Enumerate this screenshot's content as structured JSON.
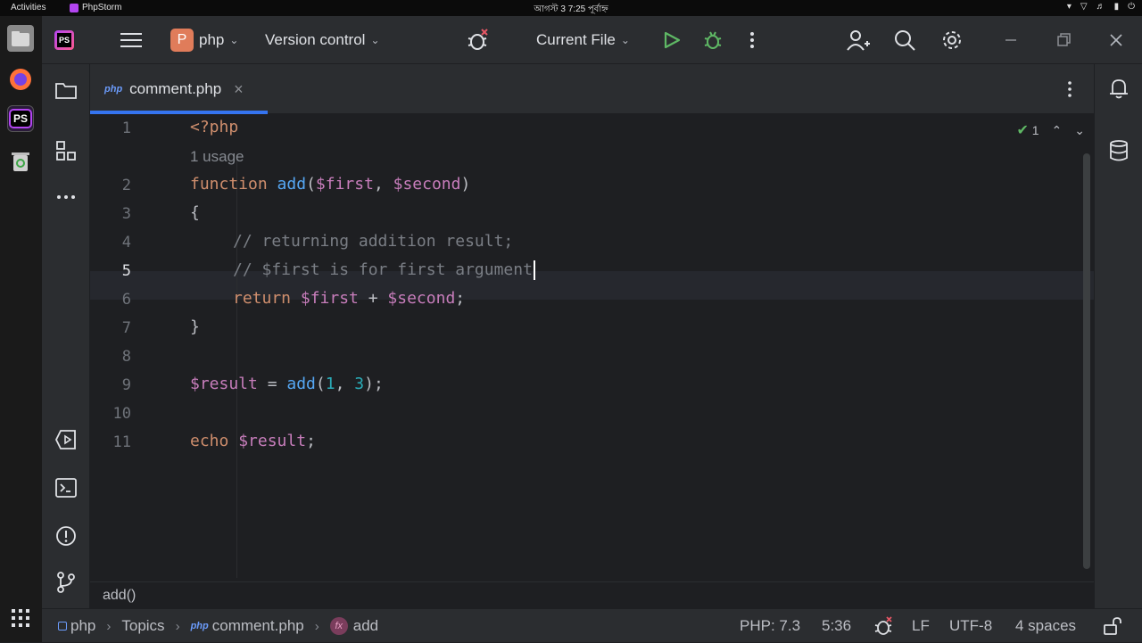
{
  "system_bar": {
    "activities": "Activities",
    "app_name": "PhpStorm",
    "clock": "আগস্ট 3  7:25 পূর্বাহ্ন"
  },
  "dock": {
    "items": [
      {
        "name": "files-app-icon",
        "color": "#9b9b9b"
      },
      {
        "name": "firefox-icon",
        "color": "#ff7139"
      },
      {
        "name": "phpstorm-icon",
        "color": "#b345f1"
      },
      {
        "name": "trash-icon",
        "color": "#4caf50"
      }
    ],
    "apps_grid_icon": "apps-grid-icon",
    "phpstorm_label": "PS"
  },
  "titlebar": {
    "project_badge": "P",
    "project_name": "php",
    "vcs_label": "Version control",
    "run_config": "Current File"
  },
  "tab": {
    "lang_badge": "php",
    "filename": "comment.php",
    "close": "×"
  },
  "inspection": {
    "count": "1"
  },
  "gutter": [
    "1",
    "2",
    "3",
    "4",
    "5",
    "6",
    "7",
    "8",
    "9",
    "10",
    "11"
  ],
  "usage_hint": "1 usage",
  "code": {
    "l1": "<?php",
    "l2_kw": "function",
    "l2_fn": "add",
    "l2_p1": "(",
    "l2_v1": "$first",
    "l2_p2": ", ",
    "l2_v2": "$second",
    "l2_p3": ")",
    "l3": "{",
    "l4": "// returning addition result;",
    "l5": "// $first is for first argument",
    "l6_kw": "return",
    "l6_v1": "$first",
    "l6_op": " + ",
    "l6_v2": "$second",
    "l6_end": ";",
    "l7": "}",
    "l9_v": "$result",
    "l9_eq": " = ",
    "l9_fn": "add",
    "l9_p1": "(",
    "l9_n1": "1",
    "l9_c": ", ",
    "l9_n2": "3",
    "l9_end": ");",
    "l11_kw": "echo",
    "l11_v": "$result",
    "l11_end": ";"
  },
  "breadcrumb_fn": "add()",
  "status": {
    "crumb_project": "php",
    "crumb_topics": "Topics",
    "crumb_lang": "php",
    "crumb_file": "comment.php",
    "crumb_fx": "fx",
    "crumb_fn": "add",
    "php_version": "PHP: 7.3",
    "position": "5:36",
    "line_sep": "LF",
    "encoding": "UTF-8",
    "indent": "4 spaces"
  },
  "colors": {
    "accent": "#3574f0",
    "run_green": "#5fb865",
    "project_badge": "#e07c5a",
    "status_icon": "#b345f1"
  }
}
